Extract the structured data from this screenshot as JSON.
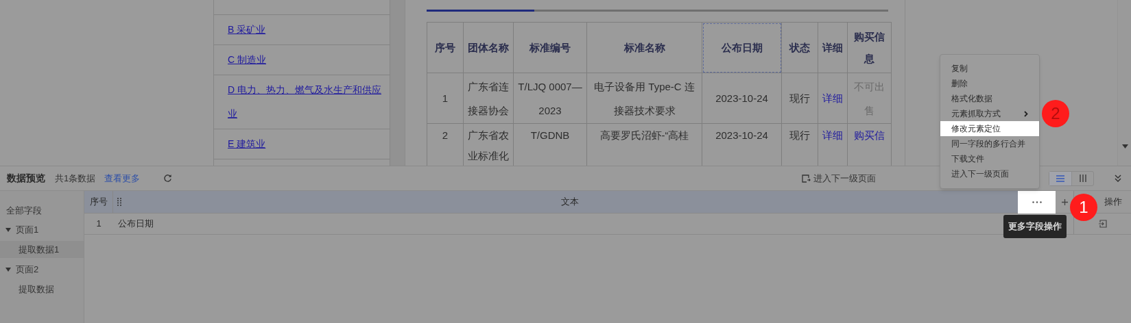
{
  "categories": [
    {
      "label": "B 采矿业"
    },
    {
      "label": "C 制造业"
    },
    {
      "label": "D 电力、热力、燃气及水生产和供应业"
    },
    {
      "label": "E 建筑业"
    }
  ],
  "standards_table": {
    "columns": [
      {
        "label": "序号",
        "highlighted": false
      },
      {
        "label": "团体名称",
        "highlighted": false
      },
      {
        "label": "标准编号",
        "highlighted": false
      },
      {
        "label": "标准名称",
        "highlighted": false
      },
      {
        "label": "公布日期",
        "highlighted": true
      },
      {
        "label": "状态",
        "highlighted": false
      },
      {
        "label": "详细",
        "highlighted": false
      },
      {
        "label": "购买信息",
        "highlighted": false
      }
    ],
    "rows": [
      {
        "cells": [
          {
            "text": "1",
            "kind": "plain"
          },
          {
            "text": "广东省连接器协会",
            "kind": "plain"
          },
          {
            "text": "T/LJQ 0007—2023",
            "kind": "plain"
          },
          {
            "text": "电子设备用 Type-C 连接器技术要求",
            "kind": "plain"
          },
          {
            "text": "2023-10-24",
            "kind": "plain"
          },
          {
            "text": "现行",
            "kind": "plain"
          },
          {
            "text": "详细",
            "kind": "link"
          },
          {
            "text": "不可出售",
            "kind": "muted"
          }
        ]
      },
      {
        "cells": [
          {
            "text": "2",
            "kind": "plain"
          },
          {
            "text": "广东省农业标准化",
            "kind": "plain"
          },
          {
            "text": "T/GDNB",
            "kind": "plain"
          },
          {
            "text": "高要罗氏沼虾-“高桂",
            "kind": "plain"
          },
          {
            "text": "2023-10-24",
            "kind": "plain"
          },
          {
            "text": "现行",
            "kind": "plain"
          },
          {
            "text": "详细",
            "kind": "link"
          },
          {
            "text": "购买信",
            "kind": "link"
          }
        ]
      }
    ]
  },
  "preview": {
    "title": "数据预览",
    "count": "共1条数据",
    "more_link": "查看更多",
    "next_page_button": "进入下一级页面",
    "view_modes": [
      {
        "kind": "list",
        "selected": true
      },
      {
        "kind": "columns",
        "selected": false
      }
    ]
  },
  "sidebar": {
    "title": "全部字段",
    "pages": [
      {
        "label": "页面1",
        "expanded": true,
        "children": [
          {
            "label": "提取数据1",
            "selected": true
          }
        ]
      },
      {
        "label": "页面2",
        "expanded": true,
        "children": [
          {
            "label": "提取数据",
            "selected": false
          }
        ]
      }
    ]
  },
  "data_table": {
    "columns": [
      {
        "label": "序号"
      },
      {
        "label": "文本"
      },
      {
        "label": "操作"
      }
    ],
    "rows": [
      {
        "cells": [
          "1",
          "公布日期"
        ]
      }
    ]
  },
  "tooltip": "更多字段操作",
  "context_menu": [
    {
      "label": "复制",
      "has_submenu": false,
      "highlighted": false
    },
    {
      "label": "删除",
      "has_submenu": false,
      "highlighted": false
    },
    {
      "label": "格式化数据",
      "has_submenu": false,
      "highlighted": false
    },
    {
      "label": "元素抓取方式",
      "has_submenu": true,
      "highlighted": false
    },
    {
      "label": "修改元素定位",
      "has_submenu": false,
      "highlighted": true
    },
    {
      "label": "同一字段的多行合并",
      "has_submenu": false,
      "highlighted": false
    },
    {
      "label": "下载文件",
      "has_submenu": false,
      "highlighted": false
    },
    {
      "label": "进入下一级页面",
      "has_submenu": false,
      "highlighted": false
    }
  ],
  "step_badges": [
    {
      "text": "1",
      "dimmed": false
    },
    {
      "text": "2",
      "dimmed": true
    }
  ]
}
